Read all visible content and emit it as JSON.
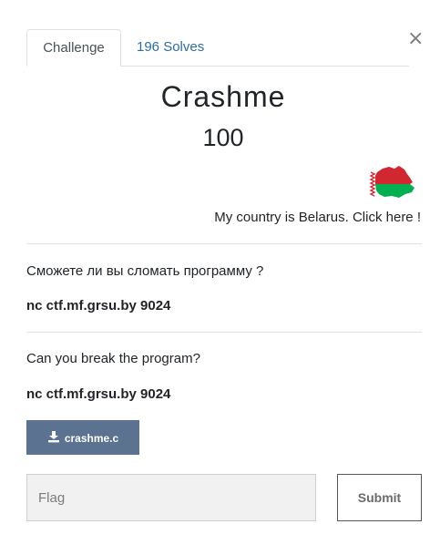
{
  "tabs": {
    "challenge_label": "Challenge",
    "solves_label": "196 Solves"
  },
  "close_glyph": "×",
  "challenge": {
    "name": "Crashme",
    "points": "100",
    "country_link": "My country is Belarus. Click here !",
    "description_ru": "Сможете ли вы сломать программу ?",
    "command_1": "nc ctf.mf.grsu.by 9024",
    "description_en": "Can you break the program?",
    "command_2": "nc ctf.mf.grsu.by 9024"
  },
  "download": {
    "label": "crashme.c",
    "icon": "download-icon"
  },
  "flag_form": {
    "placeholder": "Flag",
    "submit_label": "Submit"
  },
  "colors": {
    "link": "#2d6ca2",
    "download_bg": "#5b7390",
    "flag_red": "#d22730",
    "flag_green": "#00af50"
  }
}
